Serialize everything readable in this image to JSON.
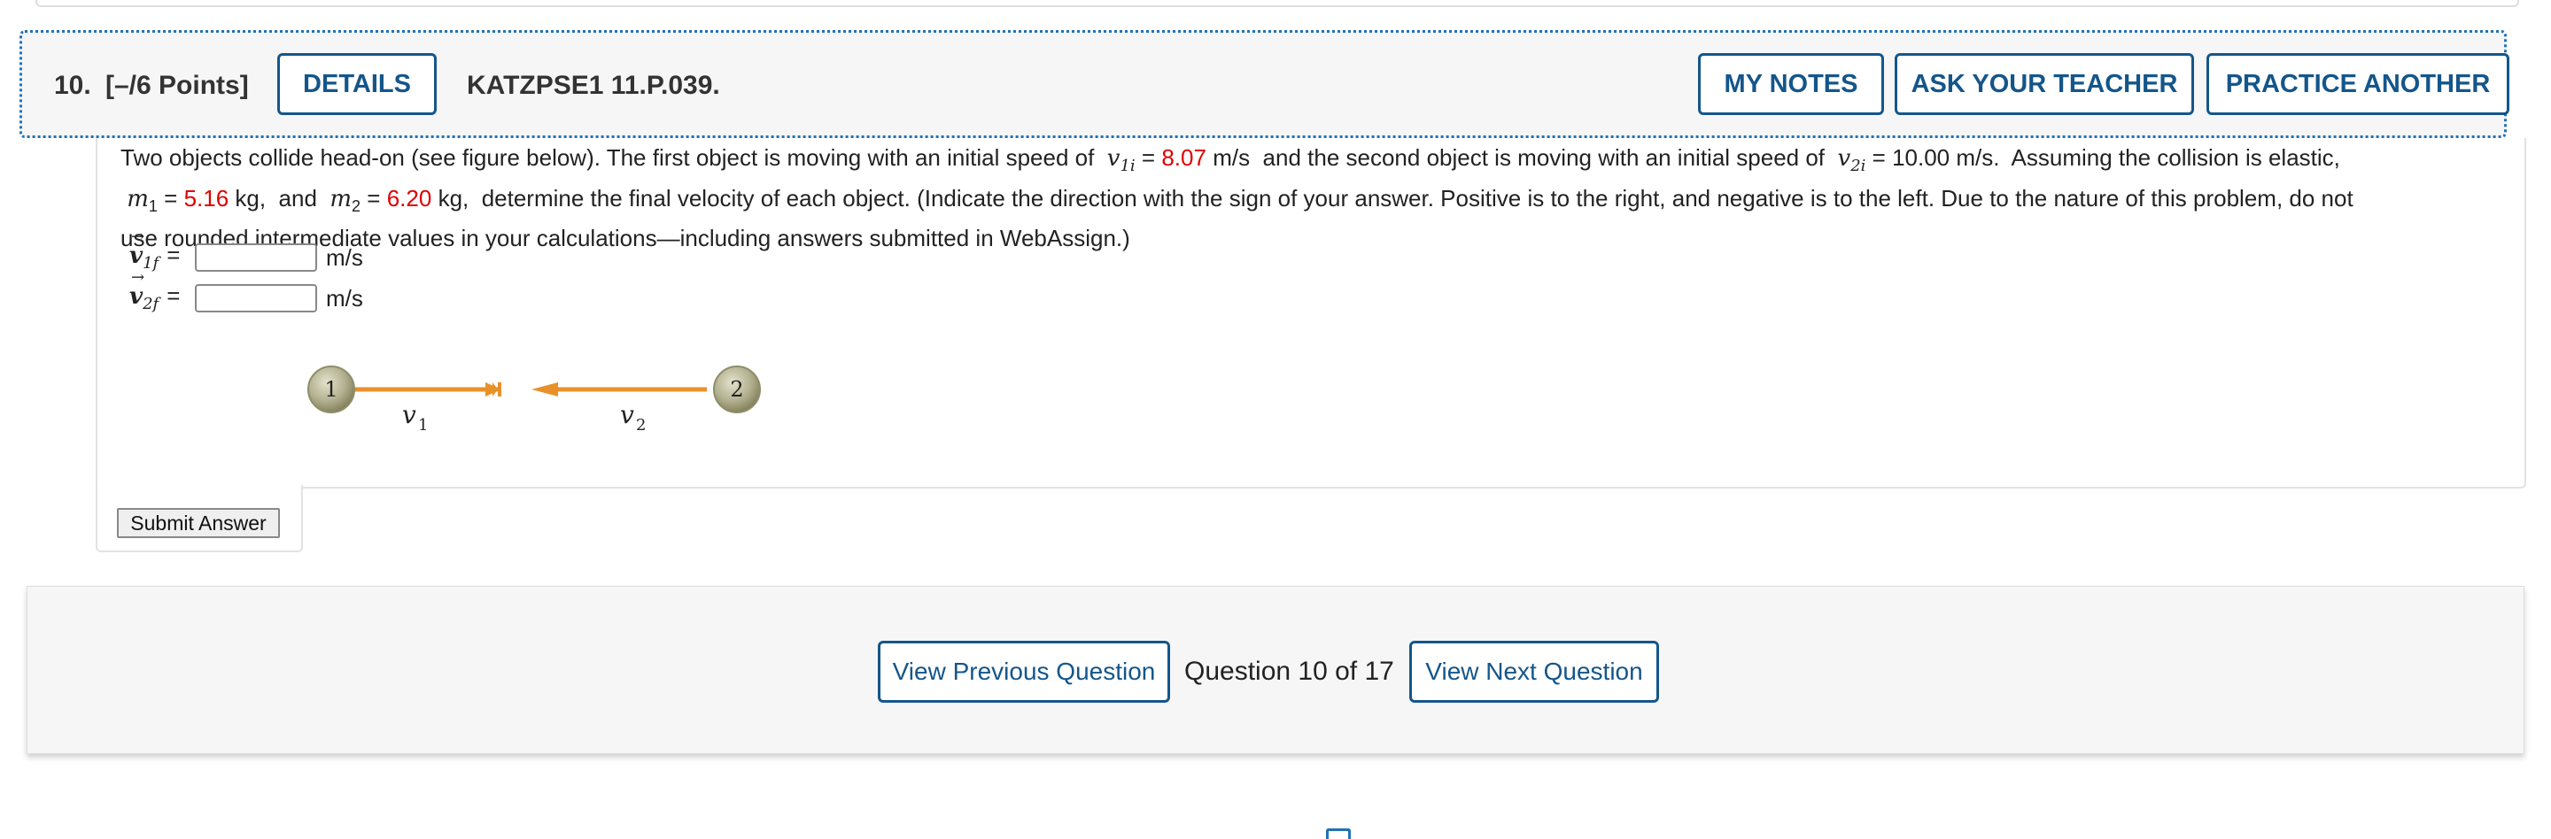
{
  "question": {
    "number": "10.",
    "points": "[–/6 Points]",
    "details_label": "DETAILS",
    "code": "KATZPSE1 11.P.039.",
    "my_notes_label": "MY NOTES",
    "ask_teacher_label": "ASK YOUR TEACHER",
    "practice_label": "PRACTICE ANOTHER"
  },
  "problem": {
    "line1_a": "Two objects collide head-on (see figure below). The first object is moving with an initial speed of",
    "v1i_sym": "v",
    "v1i_sub": "1i",
    "eq": "=",
    "v1i_value": "8.07",
    "unit_ms": "m/s",
    "line1_b": "and the second object is moving with an initial speed of",
    "v2i_sym": "v",
    "v2i_sub": "2i",
    "v2i_value": "10.00",
    "line1_c": "Assuming the collision is elastic,",
    "m1_sym": "m",
    "m1_sub": "1",
    "m1_value": "5.16",
    "unit_kg": "kg,",
    "and": "and",
    "m2_sym": "m",
    "m2_sub": "2",
    "m2_value": "6.20",
    "line2_b": "determine the final velocity of each object. (Indicate the direction with the sign of your answer. Positive is to the right, and negative is to the left. Due to the nature of this problem, do not",
    "line3": "use rounded intermediate values in your calculations—including answers submitted in WebAssign.)"
  },
  "answers": [
    {
      "sym": "v",
      "sub": "1f",
      "unit": "m/s",
      "value": ""
    },
    {
      "sym": "v",
      "sub": "2f",
      "unit": "m/s",
      "value": ""
    }
  ],
  "figure": {
    "ball1_label": "1",
    "ball2_label": "2",
    "v1_label": "v",
    "v1_sub": "1",
    "v2_label": "v",
    "v2_sub": "2",
    "arrow_color": "#e8912a"
  },
  "submit_label": "Submit Answer",
  "nav": {
    "prev_label": "View Previous Question",
    "count_label": "Question 10 of 17",
    "next_label": "View Next Question"
  },
  "colors": {
    "accent": "#14568a",
    "value_red": "#e00000",
    "focus_outline": "#1f73b7"
  }
}
